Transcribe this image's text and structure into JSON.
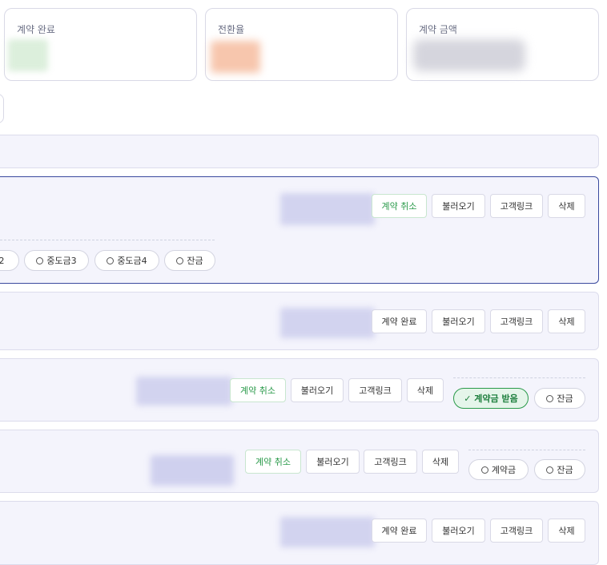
{
  "stats": {
    "contract_done": "계약 완료",
    "conversion": "전환율",
    "contract_amount": "계약 금액"
  },
  "buttons": {
    "cancel_contract": "계약 취소",
    "complete_contract": "계약 완료",
    "load": "불러오기",
    "customer_link": "고객링크",
    "delete": "삭제"
  },
  "chips": {
    "mid2_partial": "2",
    "mid3": "중도금3",
    "mid4": "중도금4",
    "balance": "잔금",
    "deposit_received": "✓ 계약금 받음",
    "deposit": "계약금"
  },
  "colors": {
    "accent_green": "#2a9a4a",
    "selected_border": "#3a4a9e",
    "row_bg": "#f4f4fc"
  }
}
